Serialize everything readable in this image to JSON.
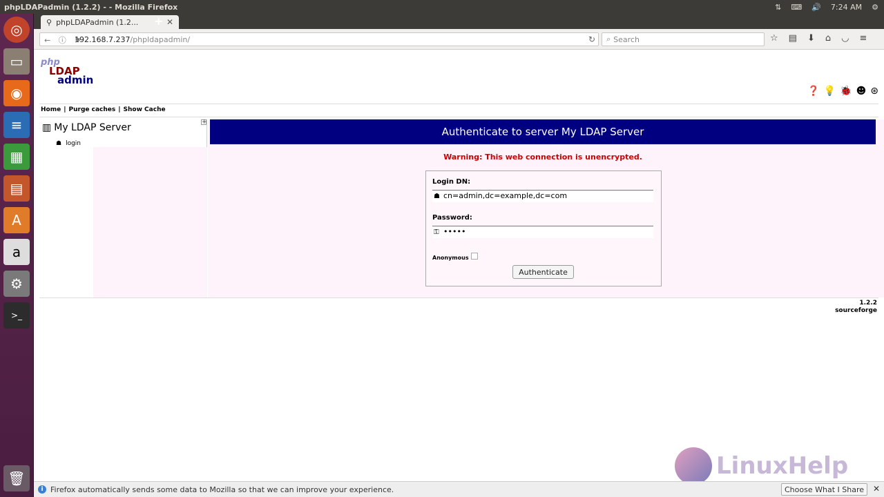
{
  "system": {
    "window_title": "phpLDAPadmin (1.2.2) - - Mozilla Firefox",
    "clock": "7:24 AM"
  },
  "browser": {
    "tab_title": "phpLDAPadmin (1.2...",
    "url_host": "192.168.7.237",
    "url_path": "/phpldapadmin/",
    "search_placeholder": "Search"
  },
  "app": {
    "logo_php": "php",
    "logo_ldap": "LDAP",
    "logo_admin": "admin",
    "menu": [
      "Home",
      "|",
      "Purge caches",
      "|",
      "Show Cache"
    ],
    "server_name": "My LDAP Server",
    "tree_login": "login",
    "auth_header": "Authenticate to server My LDAP Server",
    "warning": "Warning: This web connection is unencrypted.",
    "login_dn_label": "Login DN:",
    "login_dn_value": "cn=admin,dc=example,dc=com",
    "password_label": "Password:",
    "password_value": "•••••",
    "anonymous_label": "Anonymous",
    "anonymous_checked": false,
    "auth_button": "Authenticate",
    "version": "1.2.2",
    "sourceforge": "sourceforge"
  },
  "watermark": "LinuxHelp",
  "notification": {
    "text": "Firefox automatically sends some data to Mozilla so that we can improve your experience.",
    "button": "Choose What I Share"
  }
}
